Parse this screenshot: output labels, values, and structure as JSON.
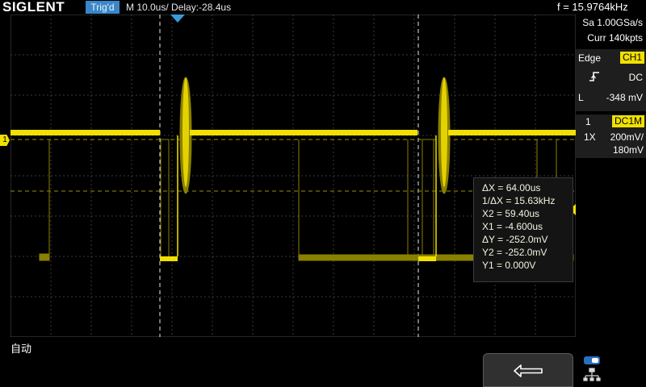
{
  "header": {
    "logo": "SIGLENT",
    "trigger_status": "Trig'd",
    "timebase": "M 10.0us/",
    "delay": "Delay:-28.4us",
    "frequency": "f = 15.9764kHz"
  },
  "acquisition": {
    "sample_rate": "Sa 1.00GSa/s",
    "memory": "Curr 140kpts"
  },
  "trigger": {
    "type": "Edge",
    "source": "CH1",
    "slope_icon": "rising-edge-icon",
    "coupling": "DC",
    "level_prefix": "L",
    "level": "-348 mV"
  },
  "channel": {
    "number": "1",
    "coupling": "DC1M",
    "probe": "1X",
    "scale": "200mV/",
    "offset": "180mV"
  },
  "cursor_readout": {
    "delta_x": "ΔX = 64.00us",
    "inv_delta_x": "1/ΔX = 15.63kHz",
    "x2": "X2 = 59.40us",
    "x1": "X1 = -4.600us",
    "delta_y": "ΔY = -252.0mV",
    "y2": "Y2 = -252.0mV",
    "y1": "Y1 = 0.000V"
  },
  "channel_marker": "1",
  "mode_label": "自动",
  "colors": {
    "trace": "#f2e000",
    "trace_dim": "#8a8000",
    "grid": "#3a3a3a",
    "trig_badge": "#3a87c8",
    "accent_yellow": "#f0e000"
  },
  "icons": [
    "back-arrow-icon",
    "network-icon",
    "trigger-position-icon",
    "trigger-level-icon"
  ]
}
